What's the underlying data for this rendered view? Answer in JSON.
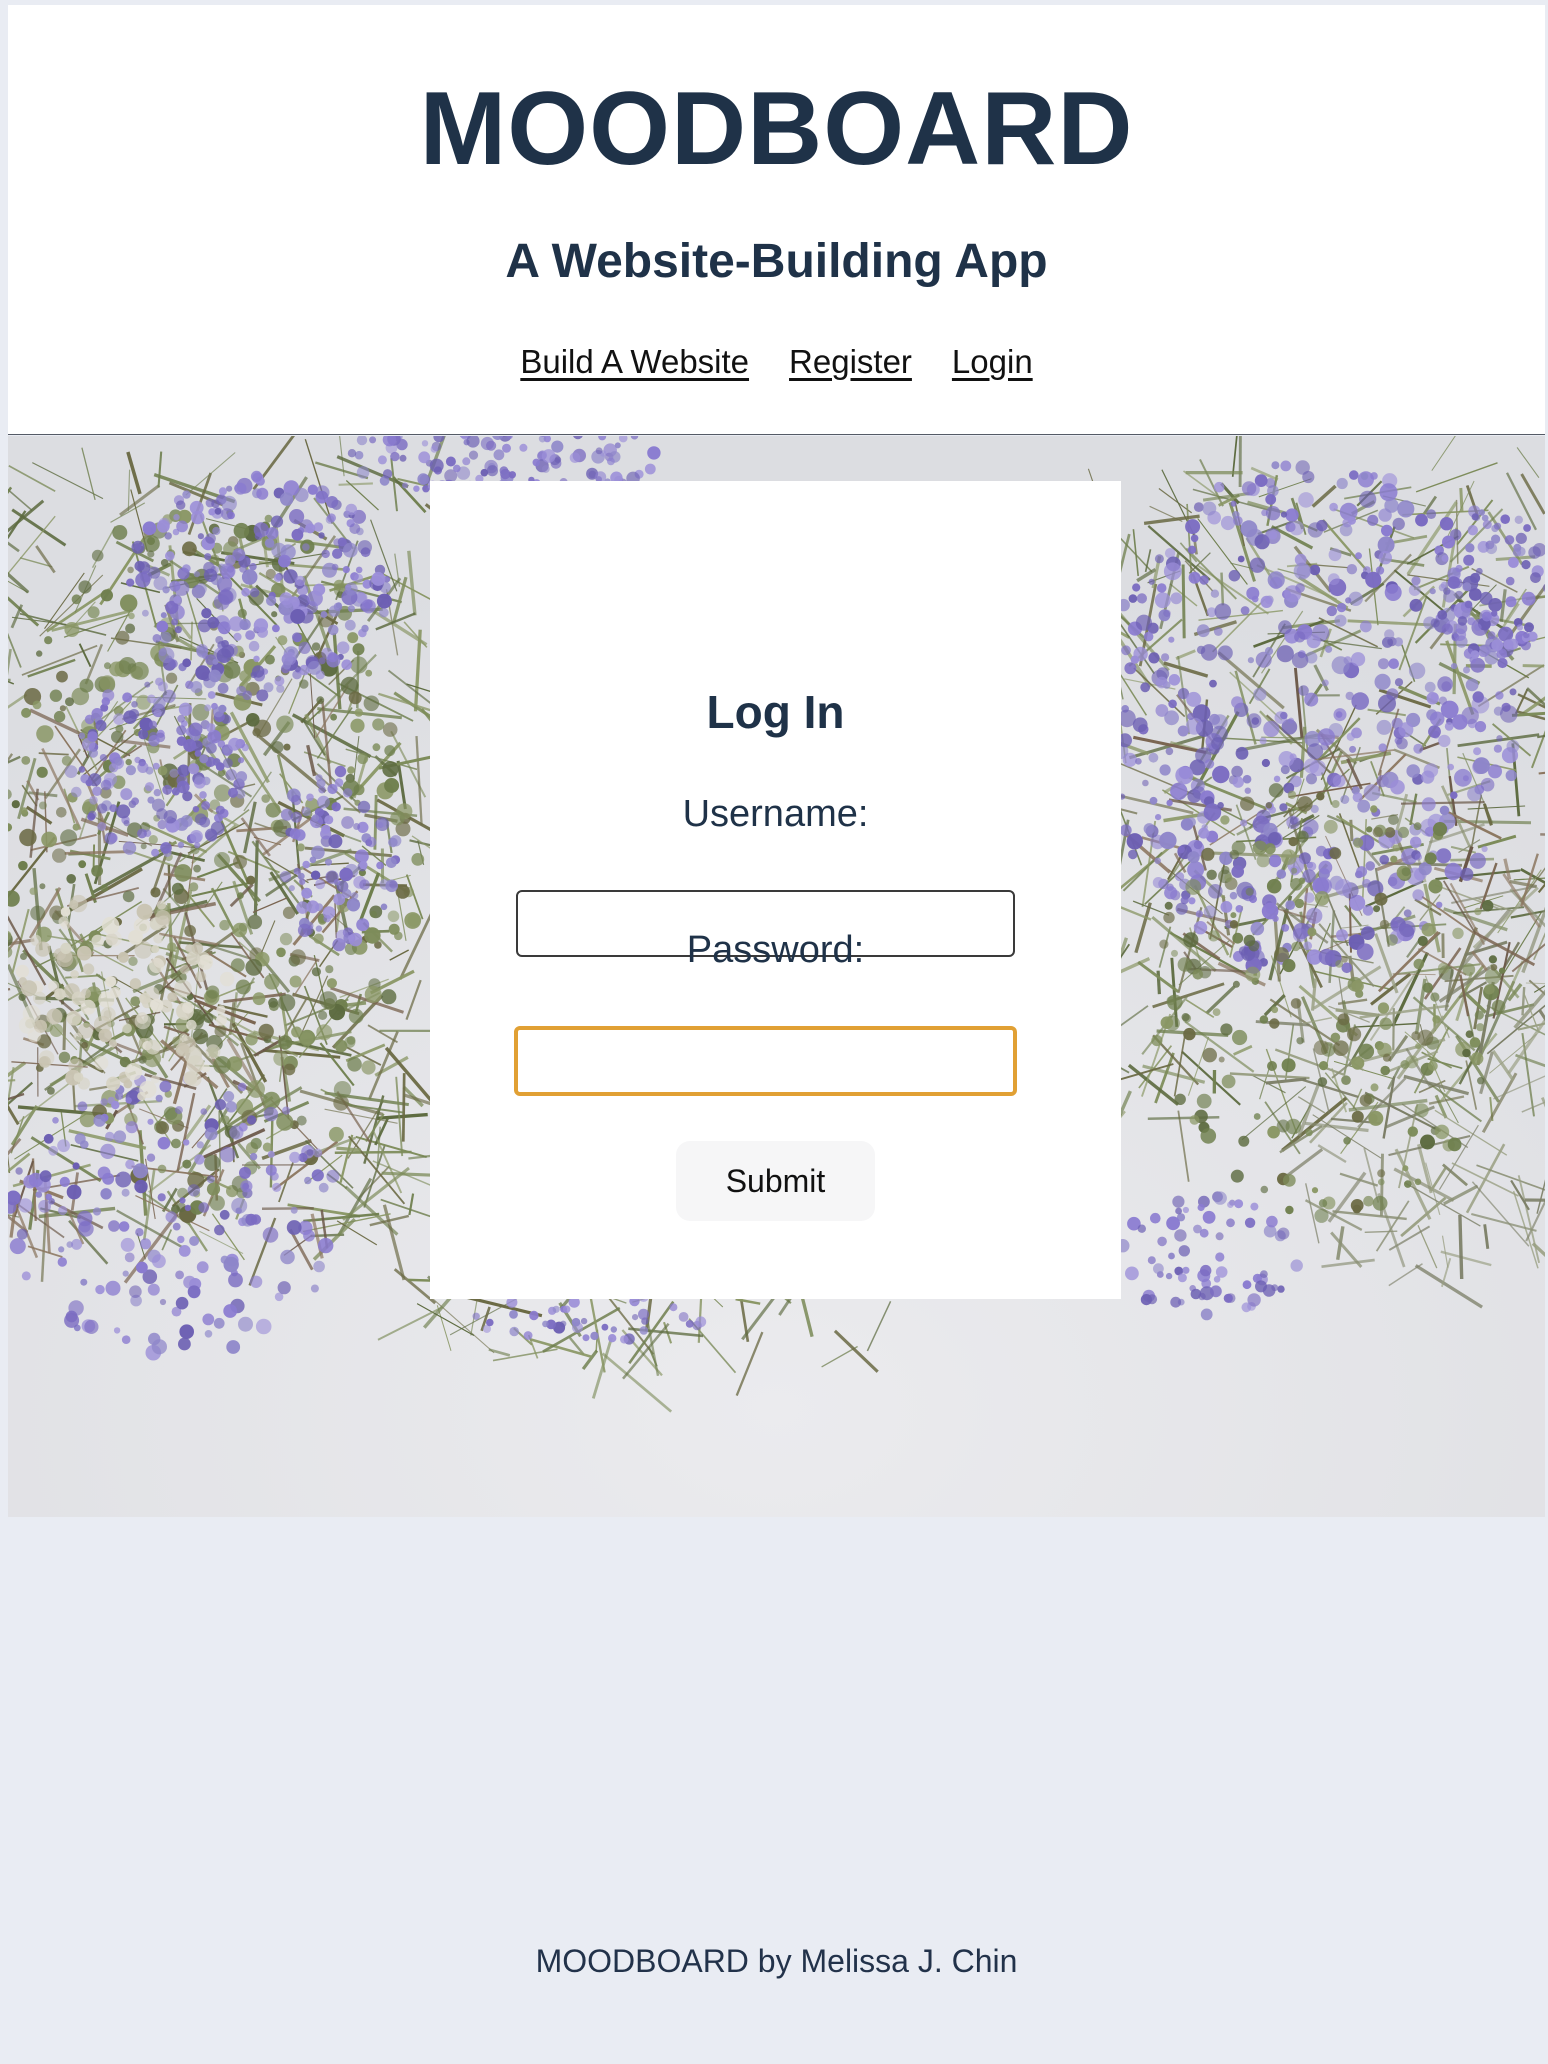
{
  "header": {
    "title": "MOODBOARD",
    "subtitle": "A Website-Building App",
    "nav": [
      {
        "label": "Build A Website"
      },
      {
        "label": "Register"
      },
      {
        "label": "Login"
      }
    ]
  },
  "login": {
    "title": "Log In",
    "username_label": "Username:",
    "username_value": "",
    "password_label": "Password:",
    "password_value": "",
    "submit_label": "Submit"
  },
  "footer": {
    "text": "MOODBOARD by Melissa J. Chin"
  },
  "colors": {
    "heading": "#1f3248",
    "page_background": "#e9ecf3",
    "focus_outline": "#e1a034",
    "flower_purple": "#7b6cc2",
    "foliage_green": "#6f7f4e"
  },
  "hero_image": "dried-lavender-flowers-photo"
}
